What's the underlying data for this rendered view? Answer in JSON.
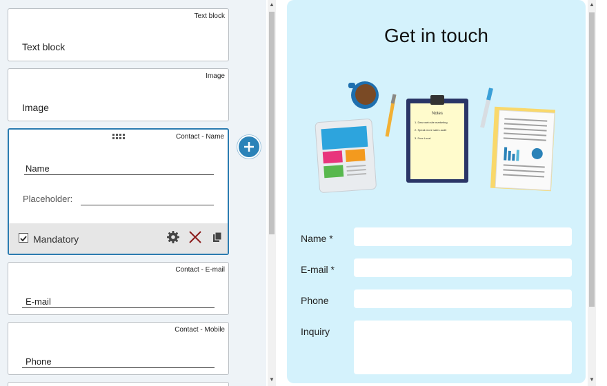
{
  "editor": {
    "cards": [
      {
        "type_label": "Text block",
        "title": "Text block"
      },
      {
        "type_label": "Image",
        "title": "Image"
      },
      {
        "type_label": "Contact - Name",
        "title": "Name",
        "placeholder_label": "Placeholder:",
        "mandatory_label": "Mandatory",
        "mandatory_checked": true
      },
      {
        "type_label": "Contact - E-mail",
        "title": "E-mail"
      },
      {
        "type_label": "Contact - Mobile",
        "title": "Phone"
      }
    ],
    "icons": {
      "drag": "drag-handle-icon",
      "settings": "gear-icon",
      "delete": "close-icon",
      "copy": "copy-icon",
      "add": "plus-icon"
    }
  },
  "preview": {
    "title": "Get in touch",
    "notes_heading": "Notes",
    "notes_lines": [
      "1. Dear web site marketing",
      "2. Speak more sales audit",
      "3. Free Local"
    ],
    "fields": [
      {
        "label": "Name *"
      },
      {
        "label": "E-mail *"
      },
      {
        "label": "Phone"
      },
      {
        "label": "Inquiry"
      }
    ]
  },
  "colors": {
    "accent": "#2a82b8",
    "preview_bg": "#d4f2fc",
    "editor_bg": "#eef3f7",
    "delete_red": "#8b1a1a"
  }
}
